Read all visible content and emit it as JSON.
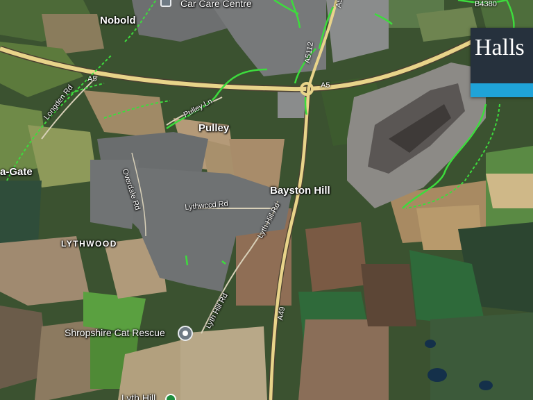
{
  "map": {
    "view": "satellite",
    "places": [
      {
        "key": "nobold",
        "text": "Nobold"
      },
      {
        "key": "pulley",
        "text": "Pulley"
      },
      {
        "key": "bayston_hill",
        "text": "Bayston Hill"
      },
      {
        "key": "lythwood",
        "text": "LYTHWOOD"
      },
      {
        "key": "gate",
        "text": "a-Gate"
      }
    ],
    "roads": {
      "a5_left": "A5",
      "a5_right": "A5",
      "a5112": "A5112",
      "a49": "A49",
      "b4380": "B4380",
      "longden_rd": "Longden Rd",
      "pulley_ln": "Pulley Ln",
      "overdale_rd": "Overdale Rd",
      "lythwood_rd": "Lythwccd Rd",
      "lyth_hill_rd_upper": "Lyth Hill Rd",
      "lyth_hill_rd_lower": "Lyth Hill Rd"
    },
    "pois": {
      "car_care": "Car Care Centre",
      "cat_rescue": "Shropshire Cat Rescue",
      "lyth_hill": "Lyth Hill"
    },
    "overlay": {
      "logo_text": "Halls",
      "logo_bg": "#26313d",
      "logo_stripe": "#1fa3d8"
    },
    "colors": {
      "main_road": "#e8d48a",
      "cycle_path": "#3ddc3d",
      "field_dark": "#2f4a26",
      "quarry": "#8c8a86"
    }
  }
}
